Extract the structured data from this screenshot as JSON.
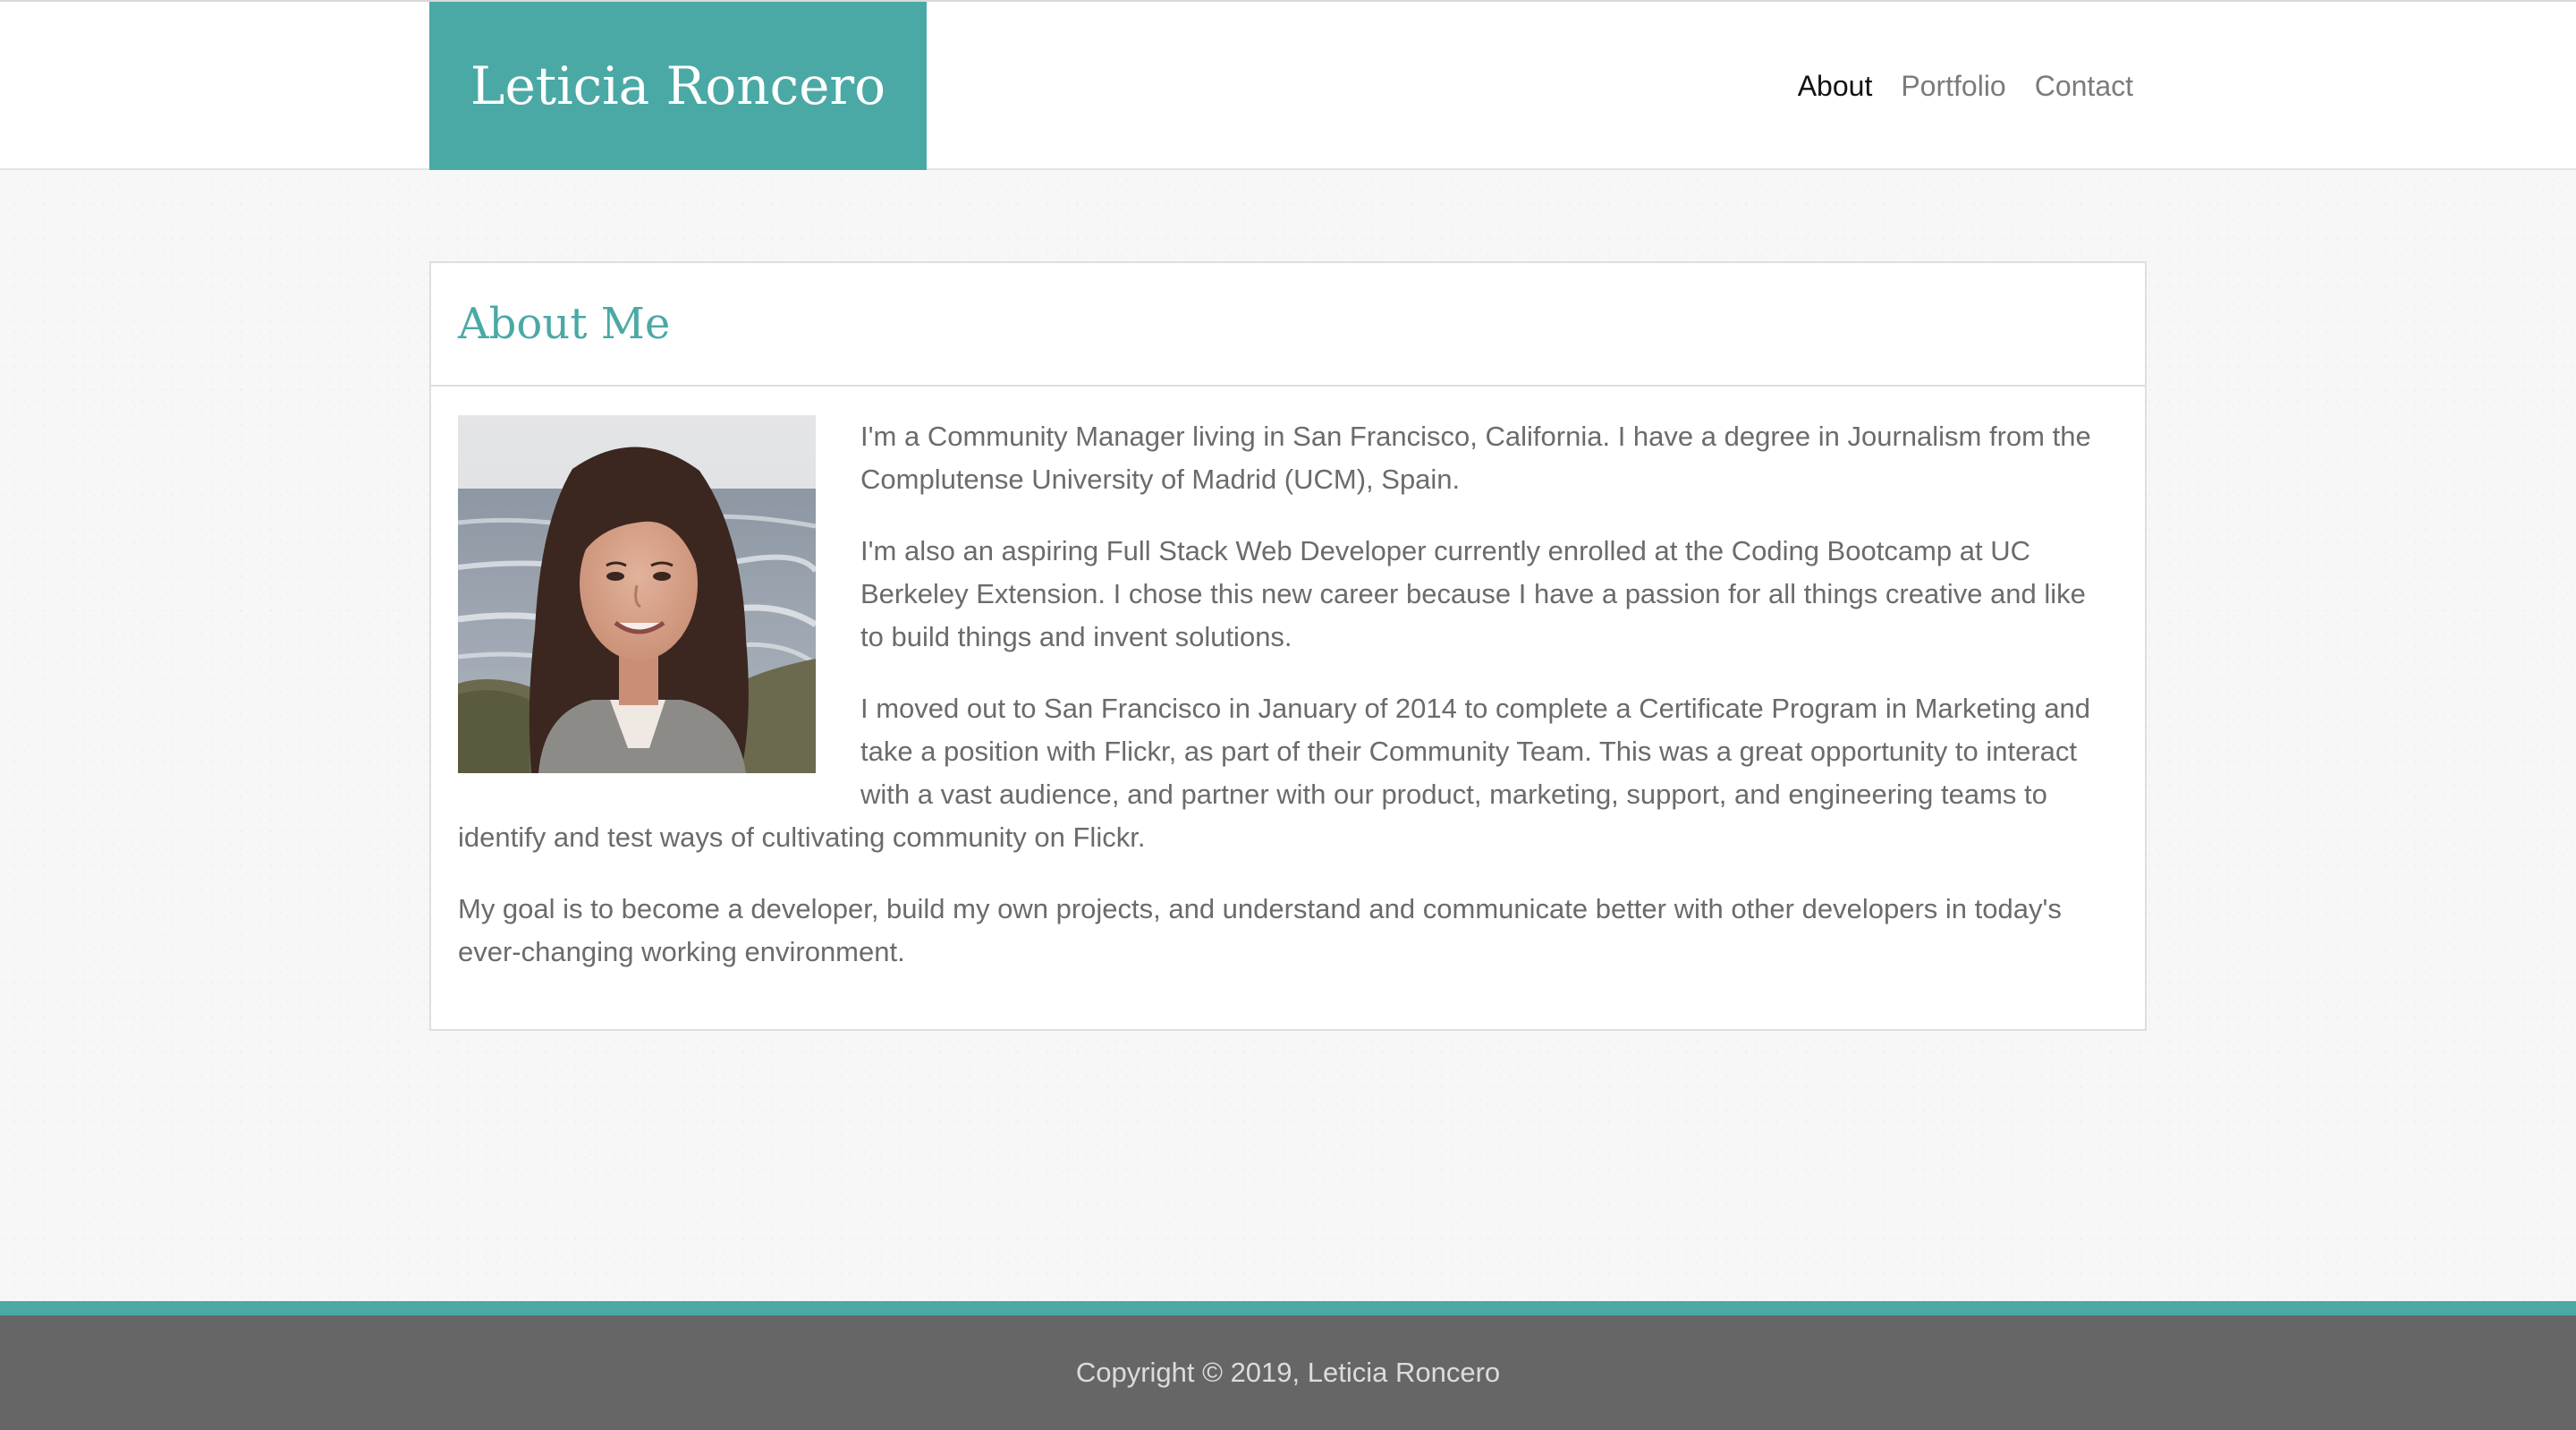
{
  "header": {
    "brand": "Leticia Roncero",
    "nav": [
      {
        "label": "About",
        "active": true
      },
      {
        "label": "Portfolio",
        "active": false
      },
      {
        "label": "Contact",
        "active": false
      }
    ]
  },
  "about": {
    "title": "About Me",
    "paragraphs": [
      "I'm a Community Manager living in San Francisco, California. I have a degree in Journalism from the Complutense University of Madrid (UCM), Spain.",
      "I'm also an aspiring Full Stack Web Developer currently enrolled at the Coding Bootcamp at UC Berkeley Extension. I chose this new career because I have a passion for all things creative and like to build things and invent solutions.",
      "I moved out to San Francisco in January of 2014 to complete a Certificate Program in Marketing and take a position with Flickr, as part of their Community Team. This was a great opportunity to interact with a vast audience, and partner with our product, marketing, support, and engineering teams to identify and test ways of cultivating community on Flickr.",
      "My goal is to become a developer, build my own projects, and understand and communicate better with other developers in today's ever-changing working environment."
    ]
  },
  "footer": {
    "copyright": "Copyright © 2019, Leticia Roncero"
  },
  "colors": {
    "accent": "#4aa9a5",
    "footer_bg": "#666666",
    "body_text": "#6b6b6b",
    "nav_active": "#111111",
    "nav_inactive": "#7b7b7b"
  }
}
